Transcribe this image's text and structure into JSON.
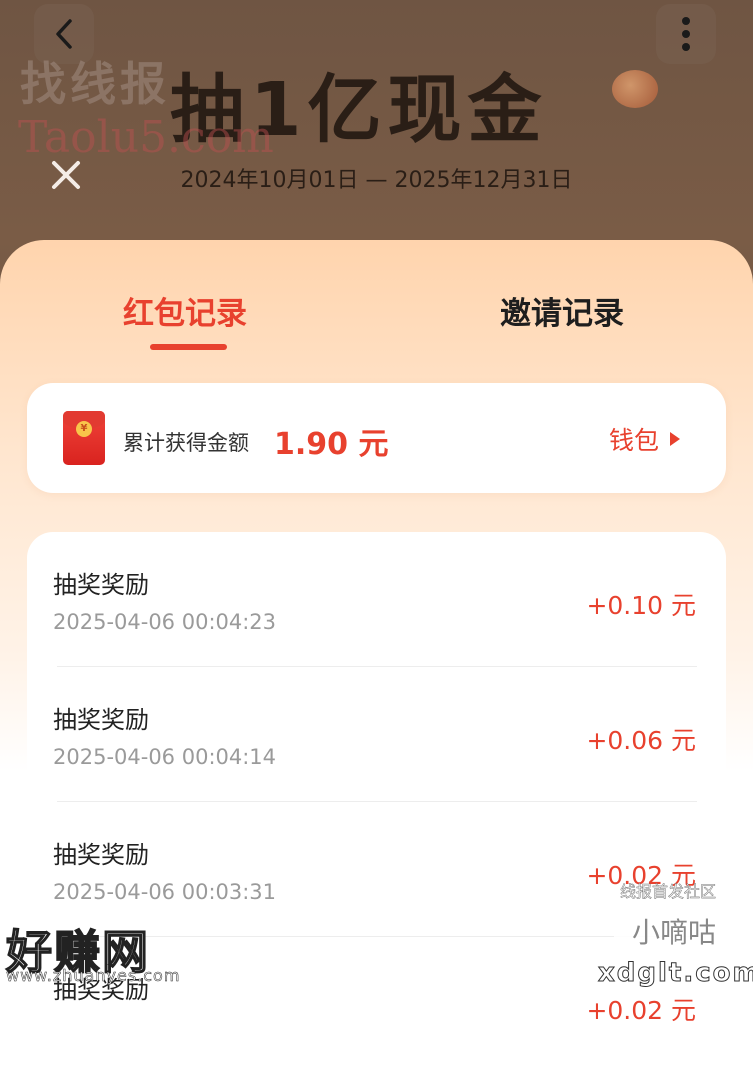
{
  "banner": {
    "title": "抽1亿现金",
    "dates": "2024年10月01日 — 2025年12月31日"
  },
  "tabs": [
    {
      "label": "红包记录",
      "active": true
    },
    {
      "label": "邀请记录",
      "active": false
    }
  ],
  "summary": {
    "label": "累计获得金额",
    "amount": "1.90 元",
    "wallet_label": "钱包"
  },
  "records": [
    {
      "title": "抽奖奖励",
      "time": "2025-04-06 00:04:23",
      "amount": "+0.10 元"
    },
    {
      "title": "抽奖奖励",
      "time": "2025-04-06 00:04:14",
      "amount": "+0.06 元"
    },
    {
      "title": "抽奖奖励",
      "time": "2025-04-06 00:03:31",
      "amount": "+0.02 元"
    },
    {
      "title": "抽奖奖励",
      "time": "",
      "amount": "+0.02 元"
    }
  ],
  "watermarks": {
    "top_left_cn": "找线报",
    "top_left_en": "Taolu5.com",
    "bottom_left_cn": "好赚网",
    "bottom_left_url": "www.zhuanyes.com",
    "bottom_right_caption": "线报首发社区",
    "bottom_right_logo": "小嘀咕",
    "bottom_right_url": "xdglt.com"
  },
  "colors": {
    "accent": "#e8412e",
    "banner_dim": "#6f5543",
    "sheet_top": "#ffd4ad"
  },
  "icons": {
    "back": "chevron-left-icon",
    "more": "vertical-dots-icon",
    "close": "close-icon",
    "envelope": "red-envelope-icon",
    "wallet_arrow": "triangle-right-icon"
  }
}
